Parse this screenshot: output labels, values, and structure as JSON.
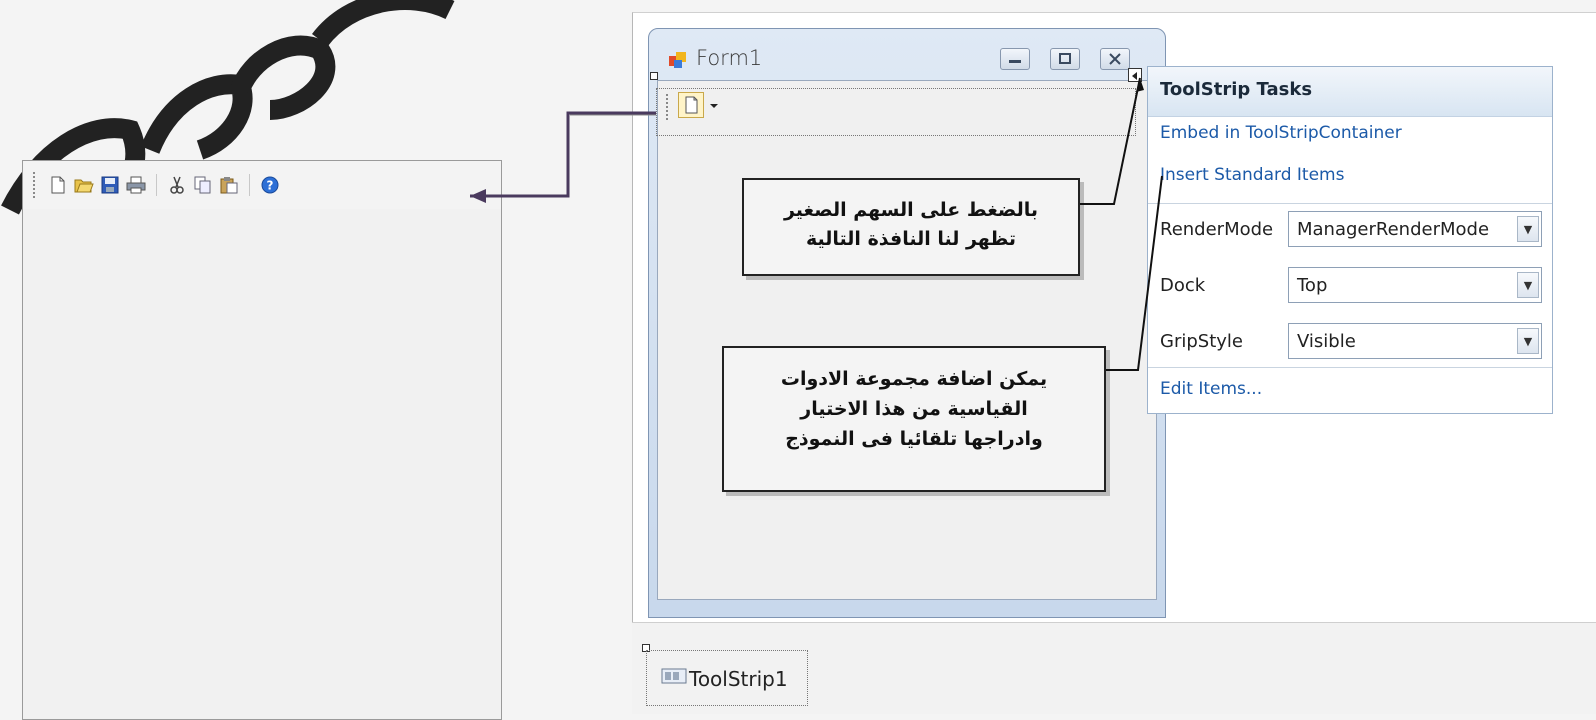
{
  "form": {
    "title": "Form1"
  },
  "tasks_panel": {
    "title": "ToolStrip Tasks",
    "embed_link": "Embed in ToolStripContainer",
    "insert_link": "Insert Standard Items",
    "properties": [
      {
        "label": "RenderMode",
        "value": "ManagerRenderMode"
      },
      {
        "label": "Dock",
        "value": "Top"
      },
      {
        "label": "GripStyle",
        "value": "Visible"
      }
    ],
    "edit_link": "Edit Items..."
  },
  "callouts": {
    "top": [
      "بالضغط على السهم الصغير",
      "تظهر لنا النافذة التالية"
    ],
    "bottom": [
      "يمكن اضافة مجموعة الادوات",
      "القياسية من هذا الاختيار",
      "وادراجها تلقائيا فى النموذج"
    ]
  },
  "tray": {
    "item_label": "ToolStrip1"
  },
  "left_toolbar": {
    "icons": [
      "new-icon",
      "open-icon",
      "save-icon",
      "print-icon",
      "cut-icon",
      "copy-icon",
      "paste-icon",
      "help-icon"
    ]
  },
  "colors": {
    "link": "#1c5aa8",
    "arrow": "#4a3a5e"
  }
}
